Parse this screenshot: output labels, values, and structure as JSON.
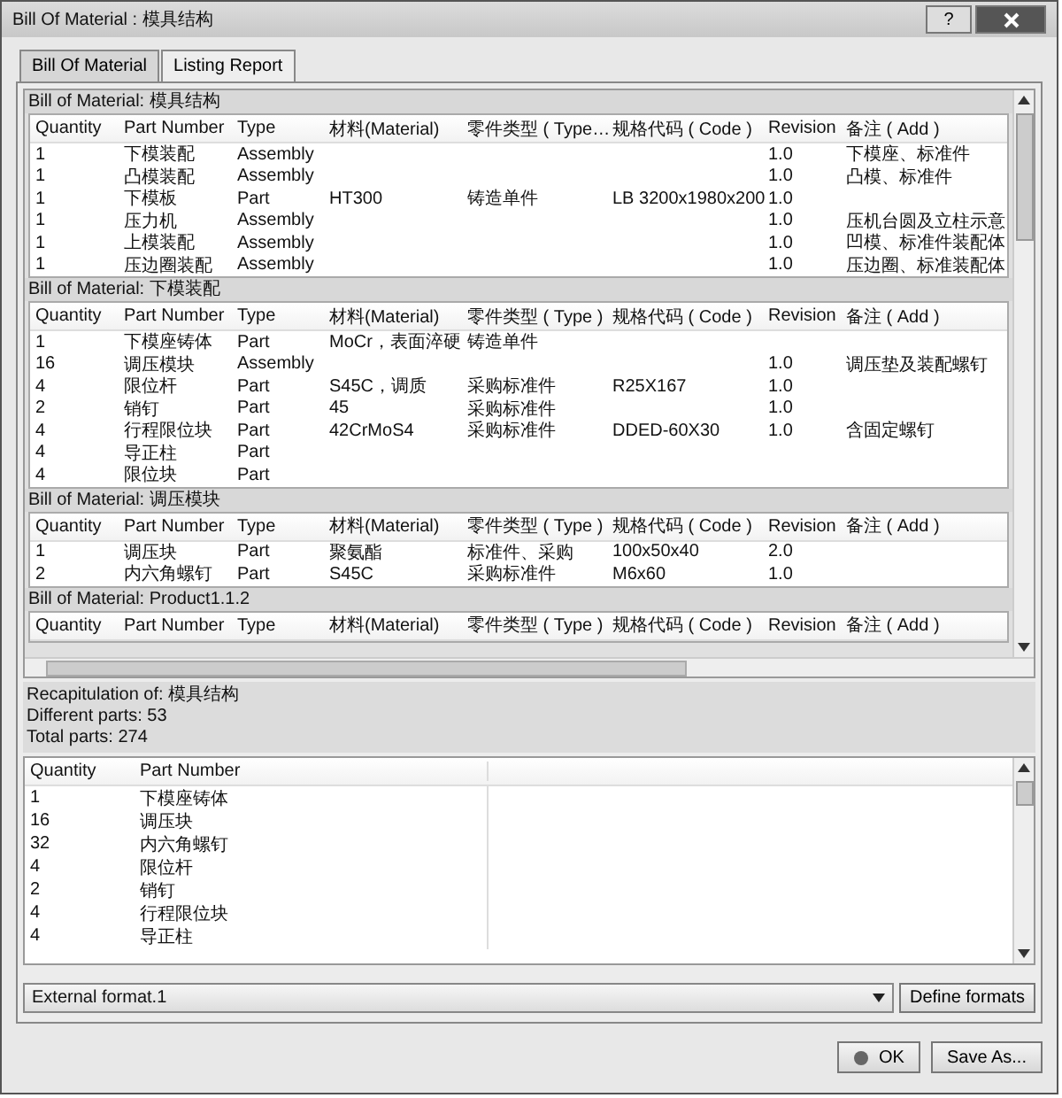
{
  "window": {
    "title": "Bill Of Material : 模具结构",
    "help": "?"
  },
  "tabs": [
    {
      "label": "Bill Of Material",
      "selected": true
    },
    {
      "label": "Listing Report",
      "selected": false
    }
  ],
  "sections": [
    {
      "title": "Bill of Material: 模具结构",
      "columns": [
        "Quantity",
        "Part Number",
        "Type",
        "材料(Material)",
        "零件类型 ( Type…",
        "规格代码 ( Code )",
        "Revision",
        "备注 ( Add )"
      ],
      "rows": [
        {
          "quantity": "1",
          "part_number": "下模装配",
          "type": "Assembly",
          "revision": "1.0",
          "note": "下模座、标准件"
        },
        {
          "quantity": "1",
          "part_number": "凸模装配",
          "type": "Assembly",
          "revision": "1.0",
          "note": "凸模、标准件"
        },
        {
          "quantity": "1",
          "part_number": "下模板",
          "type": "Part",
          "material": "HT300",
          "part_type": "铸造单件",
          "code": "LB 3200x1980x200",
          "revision": "1.0"
        },
        {
          "quantity": "1",
          "part_number": "压力机",
          "type": "Assembly",
          "revision": "1.0",
          "note": "压机台圆及立柱示意"
        },
        {
          "quantity": "1",
          "part_number": "上模装配",
          "type": "Assembly",
          "revision": "1.0",
          "note": "凹模、标准件装配体"
        },
        {
          "quantity": "1",
          "part_number": "压边圈装配",
          "type": "Assembly",
          "revision": "1.0",
          "note": "压边圈、标准装配体"
        }
      ]
    },
    {
      "title": "Bill of Material: 下模装配",
      "columns": [
        "Quantity",
        "Part Number",
        "Type",
        "材料(Material)",
        "零件类型 ( Type )",
        "规格代码 ( Code )",
        "Revision",
        "备注 ( Add )"
      ],
      "rows": [
        {
          "quantity": "1",
          "part_number": "下模座铸体",
          "type": "Part",
          "material": "MoCr，表面淬硬",
          "part_type": "铸造单件"
        },
        {
          "quantity": "16",
          "part_number": "调压模块",
          "type": "Assembly",
          "revision": "1.0",
          "note": "调压垫及装配螺钉"
        },
        {
          "quantity": "4",
          "part_number": "限位杆",
          "type": "Part",
          "material": "S45C，调质",
          "part_type": "采购标准件",
          "code": "R25X167",
          "revision": "1.0"
        },
        {
          "quantity": "2",
          "part_number": "销钉",
          "type": "Part",
          "material": "45",
          "part_type": "采购标准件",
          "revision": "1.0"
        },
        {
          "quantity": "4",
          "part_number": "行程限位块",
          "type": "Part",
          "material": "42CrMoS4",
          "part_type": "采购标准件",
          "code": "DDED-60X30",
          "revision": "1.0",
          "note": "含固定螺钉"
        },
        {
          "quantity": "4",
          "part_number": "导正柱",
          "type": "Part"
        },
        {
          "quantity": "4",
          "part_number": "限位块",
          "type": "Part"
        }
      ]
    },
    {
      "title": "Bill of Material: 调压模块",
      "columns": [
        "Quantity",
        "Part Number",
        "Type",
        "材料(Material)",
        "零件类型 ( Type )",
        "规格代码 ( Code )",
        "Revision",
        "备注 ( Add )"
      ],
      "rows": [
        {
          "quantity": "1",
          "part_number": "调压块",
          "type": "Part",
          "material": "聚氨酯",
          "part_type": "标准件、采购",
          "code": "100x50x40",
          "revision": "2.0"
        },
        {
          "quantity": "2",
          "part_number": "内六角螺钉",
          "type": "Part",
          "material": "S45C",
          "part_type": "采购标准件",
          "code": "M6x60",
          "revision": "1.0"
        }
      ]
    },
    {
      "title": "Bill of Material: Product1.1.2",
      "columns": [
        "Quantity",
        "Part Number",
        "Type",
        "材料(Material)",
        "零件类型 ( Type )",
        "规格代码 ( Code )",
        "Revision",
        "备注 ( Add )"
      ]
    }
  ],
  "recap": {
    "title": "Recapitulation of: 模具结构",
    "different_parts": "Different parts: 53",
    "total_parts": "Total parts: 274",
    "columns": [
      "Quantity",
      "Part Number"
    ],
    "rows": [
      {
        "quantity": "1",
        "part_number": "下模座铸体"
      },
      {
        "quantity": "16",
        "part_number": "调压块"
      },
      {
        "quantity": "32",
        "part_number": "内六角螺钉"
      },
      {
        "quantity": "4",
        "part_number": "限位杆"
      },
      {
        "quantity": "2",
        "part_number": "销钉"
      },
      {
        "quantity": "4",
        "part_number": "行程限位块"
      },
      {
        "quantity": "4",
        "part_number": "导正柱"
      }
    ]
  },
  "format": {
    "value": "External format.1",
    "define_button": "Define formats"
  },
  "buttons": [
    {
      "label": "OK",
      "kind": "ok"
    },
    {
      "label": "Save As...",
      "kind": "plain"
    }
  ]
}
